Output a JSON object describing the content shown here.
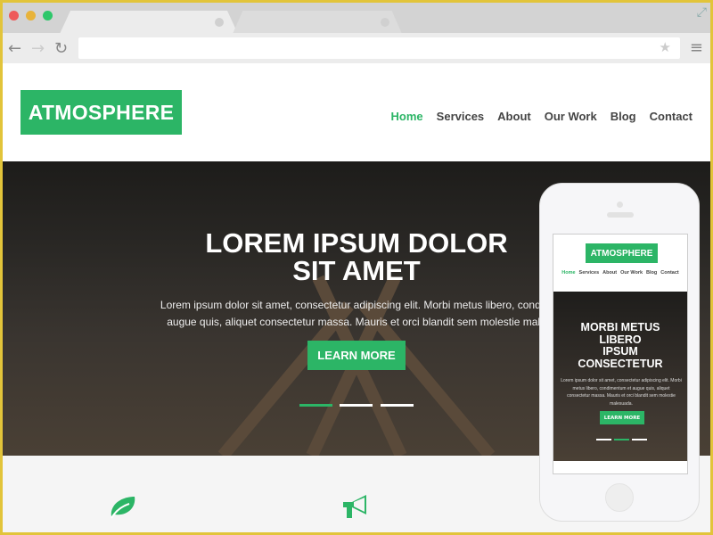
{
  "colors": {
    "accent": "#2cb566",
    "frame": "#e2c43a"
  },
  "browser": {
    "icons": [
      "back-icon",
      "forward-icon",
      "reload-icon",
      "star-icon",
      "menu-icon",
      "expand-icon"
    ]
  },
  "site": {
    "logo": "ATMOSPHERE",
    "nav": [
      "Home",
      "Services",
      "About",
      "Our Work",
      "Blog",
      "Contact"
    ],
    "active_nav": "Home",
    "hero": {
      "title_line1": "LOREM IPSUM DOLOR",
      "title_line2": "SIT AMET",
      "text_line1": "Lorem ipsum dolor sit amet, consectetur adipiscing elit. Morbi metus libero, condime",
      "text_line2": "augue quis, aliquet consectetur massa. Mauris et orci blandit sem molestie males",
      "button": "LEARN MORE",
      "active_slide": 1,
      "slides": 3
    },
    "features": {
      "icons": [
        "leaf-icon",
        "megaphone-icon"
      ]
    }
  },
  "mobile": {
    "logo": "ATMOSPHERE",
    "nav": [
      "Home",
      "Services",
      "About",
      "Our Work",
      "Blog",
      "Contact"
    ],
    "hero": {
      "title_line1": "MORBI METUS",
      "title_line2": "LIBERO",
      "title_line3": "IPSUM",
      "title_line4": "CONSECTETUR",
      "text": "Lorem ipsum dolor sit amet, consectetur adipiscing elit. Morbi metus libero, condimentum et augue quis, aliquet consectetur massa. Mauris et orci blandit sem molestie malesuada.",
      "button": "LEARN MORE",
      "active_slide": 2
    }
  }
}
